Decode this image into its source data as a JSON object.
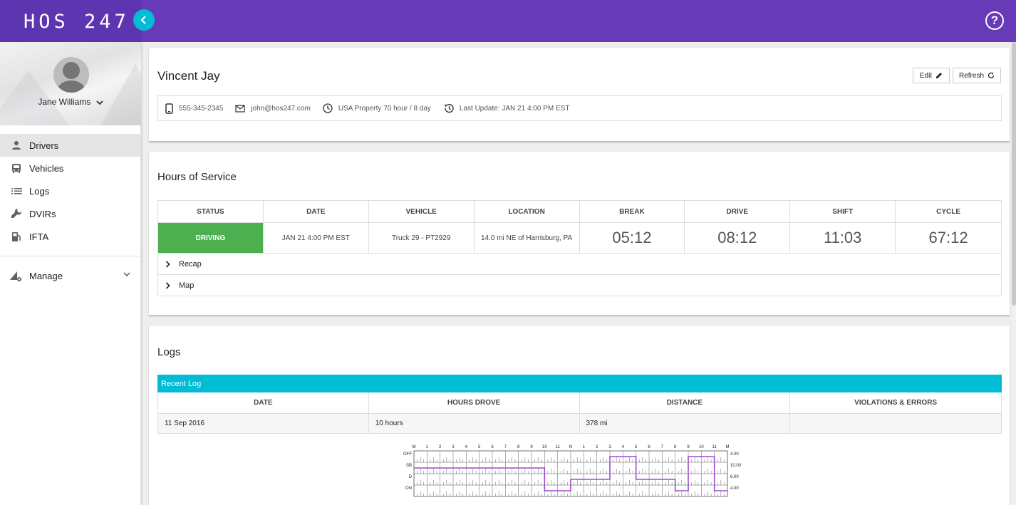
{
  "app": {
    "logo": "HOS 247"
  },
  "user": {
    "name": "Jane Williams"
  },
  "sidebar": {
    "items": [
      {
        "label": "Drivers",
        "icon": "person-icon"
      },
      {
        "label": "Vehicles",
        "icon": "bus-icon"
      },
      {
        "label": "Logs",
        "icon": "list-icon"
      },
      {
        "label": "DVIRs",
        "icon": "wrench-icon"
      },
      {
        "label": "IFTA",
        "icon": "fuel-icon"
      }
    ],
    "manage": "Manage"
  },
  "driver": {
    "name": "Vincent Jay",
    "edit_label": "Edit",
    "refresh_label": "Refresh",
    "phone": "555-345-2345",
    "email": "john@hos247.com",
    "ruleset": "USA Property 70 hour / 8 day",
    "last_update": "Last Update: JAN 21 4:00 PM EST"
  },
  "hos": {
    "title": "Hours of Service",
    "headers": [
      "STATUS",
      "DATE",
      "VEHICLE",
      "LOCATION",
      "BREAK",
      "DRIVE",
      "SHIFT",
      "CYCLE"
    ],
    "values": {
      "status": "DRIVING",
      "date": "JAN 21 4:00 PM EST",
      "vehicle": "Truck 29 - PT2929",
      "location": "14.0 mi NE of Harrisburg, PA",
      "break": "05:12",
      "drive": "08:12",
      "shift": "11:03",
      "cycle": "67:12"
    },
    "recap_label": "Recap",
    "map_label": "Map",
    "status_color": "#4caf50"
  },
  "logs": {
    "title": "Logs",
    "bar_label": "Recent Log",
    "headers": [
      "DATE",
      "HOURS DROVE",
      "DISTANCE",
      "VIOLATIONS & ERRORS"
    ],
    "row": {
      "date": "11 Sep 2016",
      "hours": "10 hours",
      "distance": "378 mi",
      "violations": ""
    }
  },
  "graph": {
    "hour_labels": [
      "M",
      "1",
      "2",
      "3",
      "4",
      "5",
      "6",
      "7",
      "8",
      "9",
      "10",
      "11",
      "N",
      "1",
      "2",
      "3",
      "4",
      "5",
      "6",
      "7",
      "8",
      "9",
      "10",
      "11",
      "M"
    ],
    "row_labels": [
      "OFF",
      "SB",
      "D",
      "ON"
    ],
    "totals": [
      "4.00",
      "10.00",
      "6.00",
      "4.00"
    ],
    "segments": [
      {
        "status": 1,
        "start": 0,
        "end": 10
      },
      {
        "status": 3,
        "start": 10,
        "end": 12
      },
      {
        "status": 2,
        "start": 12,
        "end": 15
      },
      {
        "status": 0,
        "start": 15,
        "end": 17
      },
      {
        "status": 2,
        "start": 17,
        "end": 20
      },
      {
        "status": 3,
        "start": 20,
        "end": 21
      },
      {
        "status": 0,
        "start": 21,
        "end": 23
      },
      {
        "status": 3,
        "start": 23,
        "end": 24
      }
    ],
    "line_color": "#9c4dcc"
  },
  "colors": {
    "header": "#673ab7",
    "accent": "#00bcd4"
  }
}
